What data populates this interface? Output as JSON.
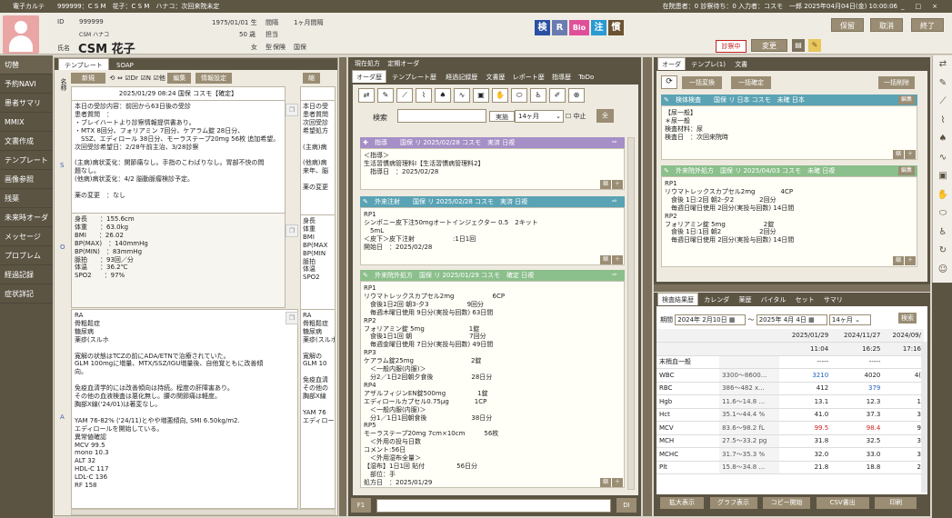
{
  "titlebar": {
    "left": "電子カルテ　　999999：C S M　花子：C S M　ハナコ：次回来院未定",
    "right": "在院患者：0  診察待ち：0  入力者：コスモ　一郎  2025年04月04日(金) 10:00:06",
    "controls": [
      "_",
      "□",
      "×"
    ]
  },
  "patient": {
    "id_label": "ID",
    "id": "999999",
    "kana": "CSM ハナコ",
    "name_label": "氏名",
    "name": "CSM 花子",
    "dob": "1975/01/01 生",
    "age": "50 歳",
    "gender": "女",
    "interval_label": "間隔",
    "interval": "1ヶ月間隔",
    "assignee_label": "担当",
    "type_label": "型",
    "insurance_label": "保険",
    "national_label": "国保"
  },
  "header_buttons": {
    "save": "保留",
    "cancel": "取消",
    "finish": "終了",
    "in_exam": "診察中",
    "change": "変更"
  },
  "logos": [
    "検",
    "R",
    "Bio",
    "注",
    "慣"
  ],
  "sidebar": [
    "切替",
    "予約NAVI",
    "患者サマリ",
    "MMIX",
    "文書作成",
    "テンプレート",
    "画像参照",
    "残薬",
    "未来時オーダ",
    "メッセージ",
    "プロブレム",
    "経過記録",
    "症状詳記"
  ],
  "left_panel": {
    "tabs": [
      "テンプレート",
      "SOAP"
    ],
    "toolbar": {
      "new": "新規",
      "dr": "Dr",
      "n": "N",
      "other": "他",
      "edit": "編集",
      "info": "情報設定",
      "shrink": "縮"
    },
    "karte_label": "名称",
    "date_header": "2025/01/29 08:24 国保 コスモ【確定】",
    "soap_text": "本日の受診内容：前回から63日後の受診\n患者質問　：\n・ブレイハートより診察情報提供書あり。\n・MTX 8回分、フォリアミン 7回分、ケアラム錠 28日分、\n　SSZ、エディロール 38日分、モーラステープ20mg 56枚 追加希望。\n次回受診希望日：2/28午前主治、3/28診察\n\n(主病)病状変化：関節痛なし。手指のこわばりなし。胃部不快の問\n題なし。\n(他病)病状変化：4/2 脳動脈瘤検診予定。\n\n薬の変更　：なし",
    "vitals_text": "身長　　：155.6cm\n体重　　：63.0kg\nBMI　　：26.02\nBP(MAX)　：140mmHg\nBP(MIN)　：83mmHg\n脈拍　　：93回／分\n体温　　：36.2℃\nSPO2　　：97%",
    "problem_text": "RA\n骨粗鬆症\n糖尿病\n薬疹(スルホ\n\n寛解の状態はTCZの前にADA/ETNで治療されていた。\nGLM 100mgに増量、MTX/SSZ/IGU増量後、自他覚ともに改善傾\n向。\n\n免疫血清学的には改善傾向は持続。程度の肝障害あり。\nその他の血液検査は悪化無し。腰の関節痛は軽度。\n胸部X線('24/01)は著変なし。\n\nYAM 76-82% ('24/11)とやや増悪傾向, SMI 6.50kg/m2.\nエディロールを開始している。\n異常値確認\nMCV 99.5\nmono 10.3\nALT 32\nHDL-C 117\nLDL-C 136\nRF 158",
    "col2_soap": "本日の受\n患者質問\n次回受診\n希望処方\n\n(主病)病\n\n(他病)病\n来年、脳\n\n薬の変更",
    "col2_vitals": "身長\n体重\nBMI\nBP(MAX\nBP(MIN\n脈拍\n体温\nSPO2",
    "col2_problem": "RA\n骨粗鬆症\n糖尿病\n薬疹(スルホ\n\n寛解の\nGLM 10\n\n免疫血清\nその他の\n胸部X線\n\nYAM 76\nエディロー"
  },
  "middle_panel": {
    "top_tabs": [
      "現在処方",
      "定期オーダ"
    ],
    "tabs": [
      "オーダ歴",
      "テンプレート歴",
      "経過記録歴",
      "文書歴",
      "レポート歴",
      "指導歴",
      "ToDo"
    ],
    "search_label": "検索",
    "search_value": "",
    "period_btn": "実施",
    "period_value": "14ヶ月",
    "stop_label": "中止",
    "all_label": "全",
    "orders": [
      {
        "header": "指導　　国保 リ 2025/02/28 コスモ　実済 日複",
        "body": "＜指導＞\n生活習慣病管理料Ⅰ【生活習慣病管理料2】\n　指導日　：2025/02/28",
        "color": "#a58fc6"
      },
      {
        "header": "外来注射　　国保 リ 2025/02/28 コスモ　実済 日複",
        "body": "RP1\nシンポニー皮下注50mgオートインジェクター 0.5　2キット\n　5mL\n＜皮下＞皮下注射　　　　　　:1日1回\n開始日　：2025/02/28",
        "color": "#5aa3b4"
      },
      {
        "header": "外来院外処方　国保 リ 2025/01/29 コスモ　確定 日複",
        "body": "RP1\nリウマトレックスカプセル2mg　　　　　　6CP\n　食後1日2回 朝3-夕3　　　　　　9回分\n　毎週木曜日使用 9日分(実投与回数) 63日間\nRP2\nフォリアミン錠 5mg　　　　　　　1錠\n　食後1日1回 朝　　　　　　　　　7回分\n　毎週金曜日使用 7日分(実投与回数) 49日間\nRP3\nケアラム錠25mg　　　　　　　　　2錠\n　＜一般内服(内服)＞\n　分2／1日2回朝夕食後　　　　　　28日分\nRP4\nアザルフィジンEN錠500mg　　　　　1錠\nエディロールカプセル0.75μg　　　　1CP\n　＜一般内服(内服)＞\n　分1／1日1回朝食後　　　　　　　38日分\nRP5\nモーラステープ20mg 7cm×10cm　　　56枚\n　＜外用の投与日数\nコメント:56日\n　＜外用湿布全量＞\n【湿布】1日1回 貼付　　　　　56日分\n　部位：手\n処方日　：2025/01/29",
        "color": "#8bbf8b"
      }
    ],
    "f1": "F1",
    "dl": "DI"
  },
  "right_panel": {
    "tabs": [
      "オーダ",
      "テンプレ(1)",
      "文書"
    ],
    "toolbar": {
      "bulk_change": "一括変換",
      "bulk_confirm": "一括確定",
      "bulk_delete": "一括削除"
    },
    "cards": [
      {
        "header": "検体検査　　国保 リ 日本 コスモ　未確 日本",
        "body": "【尿一般】\n＊尿一般\n検査材料：尿\n検査日　：次回来院時",
        "edit": "編集"
      },
      {
        "header": "外来院外処方　国保 リ 2025/04/03 コスモ　未確 日複",
        "body": "RP1\nリウマトレックスカプセル2mg　　　　4CP\n　食後 1日:2回 朝2-夕2　　　　2回分\n　毎週日曜日使用 2回分(実投与回数) 14日間\nRP2\nフォリアミン錠 5mg　　　　　　2錠\n　食後 1日:1回 朝2　　　　　　2回分\n　毎週日曜日使用 2回分(実投与回数) 14日間",
        "edit": "編集"
      }
    ]
  },
  "lab_panel": {
    "tabs": [
      "検査結果歴",
      "カレンダ",
      "薬歴",
      "バイタル",
      "セット",
      "サマリ"
    ],
    "period_label": "期間",
    "date_from": "2024年 2月10日",
    "date_to": "2025年 4月 4日",
    "range": "14ヶ月",
    "search": "検索",
    "dates": [
      "2025/01/29",
      "2024/11/27",
      "2024/09/"
    ],
    "times": [
      "11:04",
      "16:25",
      "17:16"
    ],
    "rows": [
      {
        "name": "末梢血一般",
        "ref": "",
        "v1": "-----",
        "v2": "-----",
        "v3": "",
        "c1": "#222",
        "c2": "#222"
      },
      {
        "name": "WBC",
        "ref": "3300～8600...",
        "v1": "3210",
        "v2": "4020",
        "v3": "4(",
        "c1": "#2060c0",
        "c2": "#222"
      },
      {
        "name": "RBC",
        "ref": "386～482 x...",
        "v1": "412",
        "v2": "379",
        "v3": "",
        "c1": "#222",
        "c2": "#2060c0"
      },
      {
        "name": "Hgb",
        "ref": "11.6～14.8 ...",
        "v1": "13.1",
        "v2": "12.3",
        "v3": "1",
        "c1": "#222",
        "c2": "#222"
      },
      {
        "name": "Hct",
        "ref": "35.1～44.4 %",
        "v1": "41.0",
        "v2": "37.3",
        "v3": "3",
        "c1": "#222",
        "c2": "#222"
      },
      {
        "name": "MCV",
        "ref": "83.6～98.2 fL",
        "v1": "99.5",
        "v2": "98.4",
        "v3": "9",
        "c1": "#d02020",
        "c2": "#d02020"
      },
      {
        "name": "MCH",
        "ref": "27.5～33.2 pg",
        "v1": "31.8",
        "v2": "32.5",
        "v3": "3",
        "c1": "#222",
        "c2": "#222"
      },
      {
        "name": "MCHC",
        "ref": "31.7～35.3 %",
        "v1": "32.0",
        "v2": "33.0",
        "v3": "3",
        "c1": "#222",
        "c2": "#222"
      },
      {
        "name": "Plt",
        "ref": "15.8～34.8 ...",
        "v1": "21.8",
        "v2": "18.8",
        "v3": "2",
        "c1": "#222",
        "c2": "#222"
      }
    ],
    "buttons": [
      "拡大表示",
      "グラフ表示",
      "コピー開始",
      "CSV書出",
      "印刷"
    ]
  },
  "colors": {
    "brand": "#5b5443",
    "button": "#9a8d73",
    "accent_red": "#c42020"
  }
}
